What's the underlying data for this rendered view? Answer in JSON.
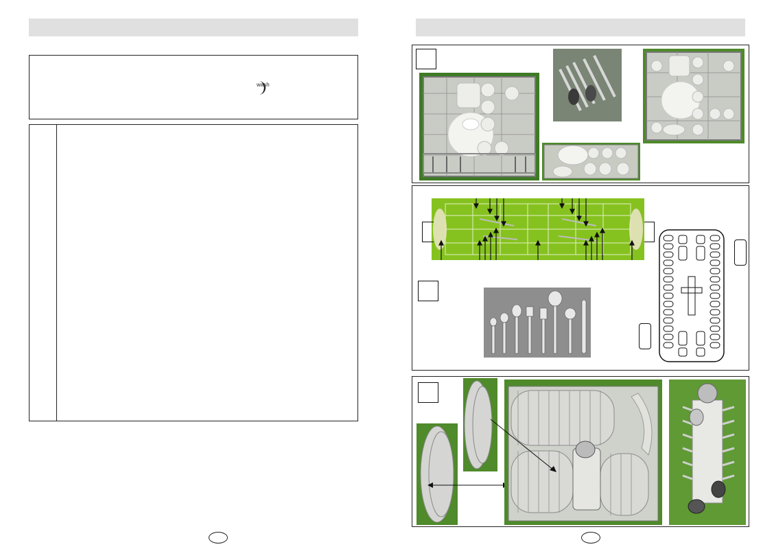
{
  "left_page": {
    "info_box": {
      "icon": "moon-wash-icon",
      "icon_text": "wash"
    }
  },
  "right_page": {},
  "colors": {
    "header_bar": "#e0e0e0",
    "rack_green": "#86c21f",
    "photo_green": "#4f8a2b",
    "cutlery_bg": "#8e8e8e"
  }
}
